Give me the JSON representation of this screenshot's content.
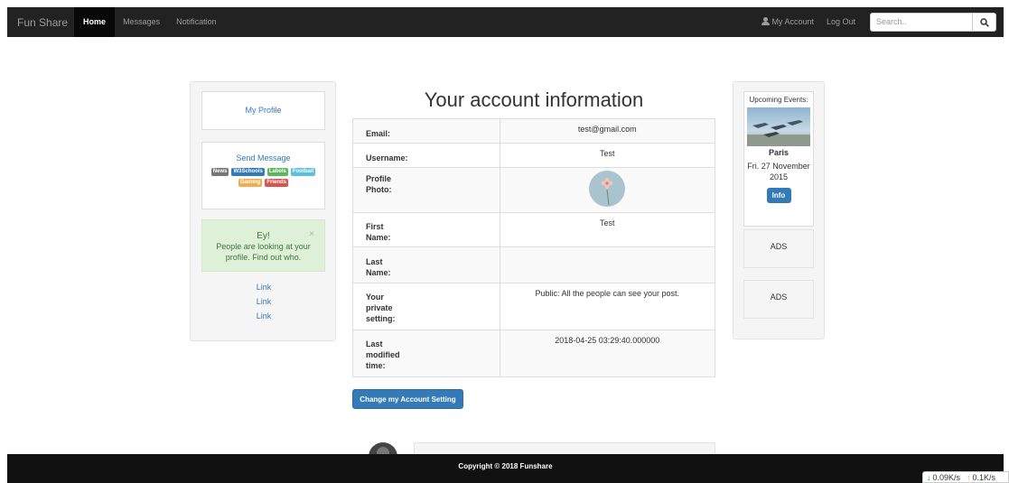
{
  "nav": {
    "brand": "Fun Share",
    "items": [
      "Home",
      "Messages",
      "Notification"
    ],
    "account": "My Account",
    "logout": "Log Out",
    "search_placeholder": "Search.."
  },
  "left": {
    "profile": "My Profile",
    "send_message": "Send Message",
    "labels": [
      {
        "text": "News",
        "color": "#777777"
      },
      {
        "text": "W3Schools",
        "color": "#337ab7"
      },
      {
        "text": "Labels",
        "color": "#5cb85c"
      },
      {
        "text": "Football",
        "color": "#5bc0de"
      },
      {
        "text": "Gaming",
        "color": "#f0ad4e"
      },
      {
        "text": "Friends",
        "color": "#d9534f"
      }
    ],
    "alert_title": "Ey!",
    "alert_text": "People are looking at your profile. Find out who.",
    "alert_close": "×",
    "links": [
      "Link",
      "Link",
      "Link"
    ]
  },
  "main": {
    "title": "Your account information",
    "rows": [
      {
        "label": "Email:",
        "value": "test@gmail.com"
      },
      {
        "label": "Username:",
        "value": "Test"
      },
      {
        "label": "Profile Photo:",
        "value": ""
      },
      {
        "label": "First Name:",
        "value": "Test"
      },
      {
        "label": "Last Name:",
        "value": ""
      },
      {
        "label": "Your private setting:",
        "value": "Public: All the people can see your post."
      },
      {
        "label": "Last modified time:",
        "value": "2018-04-25 03:29:40.000000"
      }
    ],
    "change_button": "Change my Account Setting"
  },
  "right": {
    "events_title": "Upcoming Events:",
    "city": "Paris",
    "date": "Fri. 27 November 2015",
    "info_button": "Info",
    "ads": [
      "ADS",
      "ADS"
    ]
  },
  "footer": {
    "copyright": "Copyright © 2018 Funshare"
  },
  "netspeed": {
    "down": "0.09K/s",
    "up": "0.1K/s"
  }
}
